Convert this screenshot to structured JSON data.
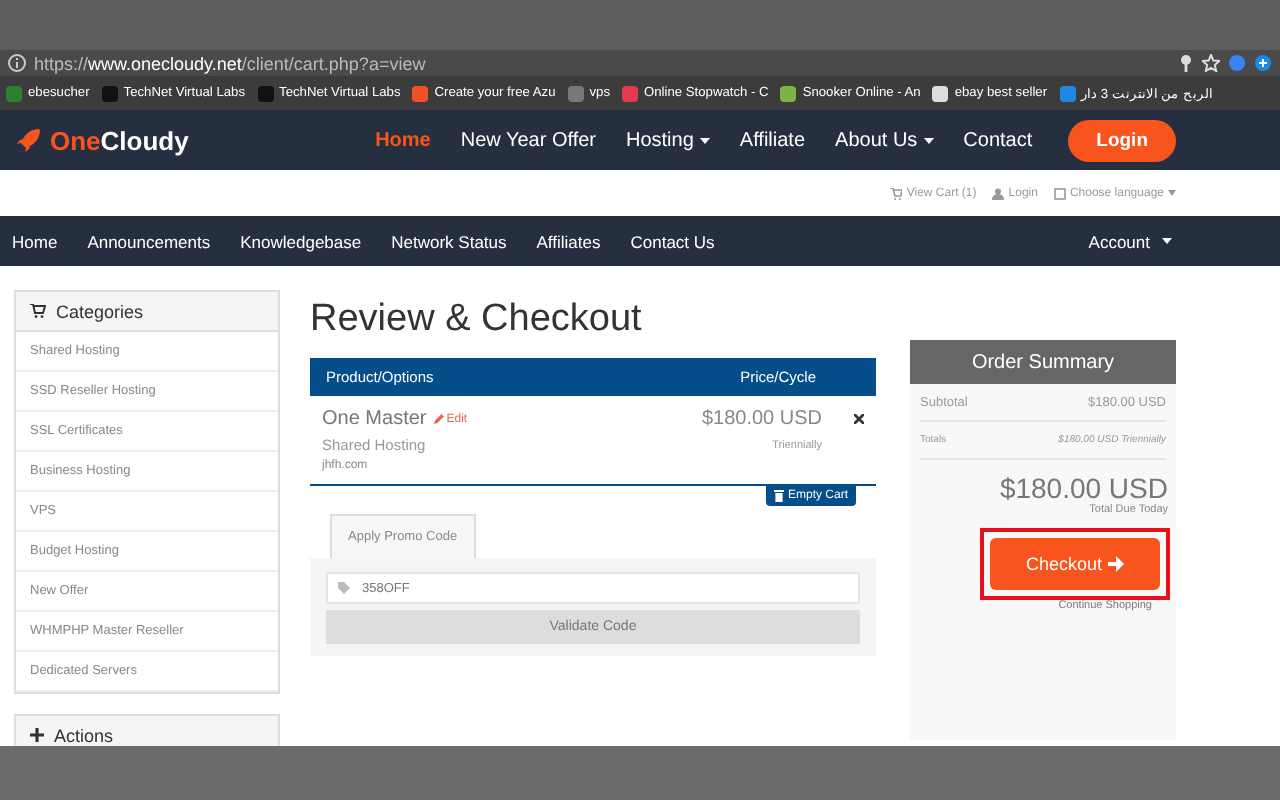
{
  "browser": {
    "url_scheme": "https://",
    "url_host": "www.onecloudy.net",
    "url_path": "/client/cart.php?a=view",
    "bookmarks": [
      {
        "label": "ebesucher",
        "color": "#2e7d32"
      },
      {
        "label": "TechNet Virtual Labs",
        "color": "#111111"
      },
      {
        "label": "TechNet Virtual Labs",
        "color": "#111111"
      },
      {
        "label": "Create your free Azu",
        "color": "#f25022"
      },
      {
        "label": "vps",
        "color": "#777777"
      },
      {
        "label": "Online Stopwatch - C",
        "color": "#e53950"
      },
      {
        "label": "Snooker Online - An",
        "color": "#7cb342"
      },
      {
        "label": "ebay best seller",
        "color": "#dddddd"
      },
      {
        "label": "الربح من الانترنت 3 دار",
        "color": "#1e88e5"
      }
    ]
  },
  "header": {
    "logo_accent": "One",
    "logo_rest": "Cloudy",
    "nav": [
      {
        "label": "Home",
        "selected": true,
        "dropdown": false
      },
      {
        "label": "New Year Offer",
        "selected": false,
        "dropdown": false
      },
      {
        "label": "Hosting",
        "selected": false,
        "dropdown": true
      },
      {
        "label": "Affiliate",
        "selected": false,
        "dropdown": false
      },
      {
        "label": "About Us",
        "selected": false,
        "dropdown": true
      },
      {
        "label": "Contact",
        "selected": false,
        "dropdown": false
      }
    ],
    "login": "Login"
  },
  "top_links": [
    {
      "kind": "cart",
      "label": "View Cart (1)"
    },
    {
      "kind": "user",
      "label": "Login"
    },
    {
      "kind": "language",
      "label": "Choose language"
    }
  ],
  "sub_nav": {
    "items": [
      "Home",
      "Announcements",
      "Knowledgebase",
      "Network Status",
      "Affiliates",
      "Contact Us"
    ],
    "account": "Account"
  },
  "sidebar": {
    "categories_title": "Categories",
    "categories": [
      "Shared Hosting",
      "SSD Reseller Hosting",
      "SSL Certificates",
      "Business Hosting",
      "VPS",
      "Budget Hosting",
      "New Offer",
      "WHMPHP Master Reseller",
      "Dedicated Servers"
    ],
    "actions_title": "Actions"
  },
  "main": {
    "title": "Review & Checkout",
    "table": {
      "columns": [
        "Product/Options",
        "Price/Cycle"
      ],
      "rows": [
        {
          "name": "One Master",
          "edit": "Edit",
          "group": "Shared Hosting",
          "domain": "jhfh.com",
          "price": "$180.00 USD",
          "cycle": "Triennially"
        }
      ]
    },
    "empty_cart": "Empty Cart",
    "promo": {
      "tab": "Apply Promo Code",
      "value": "358OFF",
      "button": "Validate Code"
    }
  },
  "summary": {
    "title": "Order Summary",
    "subtotal_label": "Subtotal",
    "subtotal": "$180.00 USD",
    "totals_label": "Totals",
    "totals": "$180.00 USD Triennially",
    "total": "$180.00 USD",
    "total_label": "Total Due Today",
    "checkout": "Checkout",
    "checkout_highlighted": true,
    "continue": "Continue Shopping"
  }
}
